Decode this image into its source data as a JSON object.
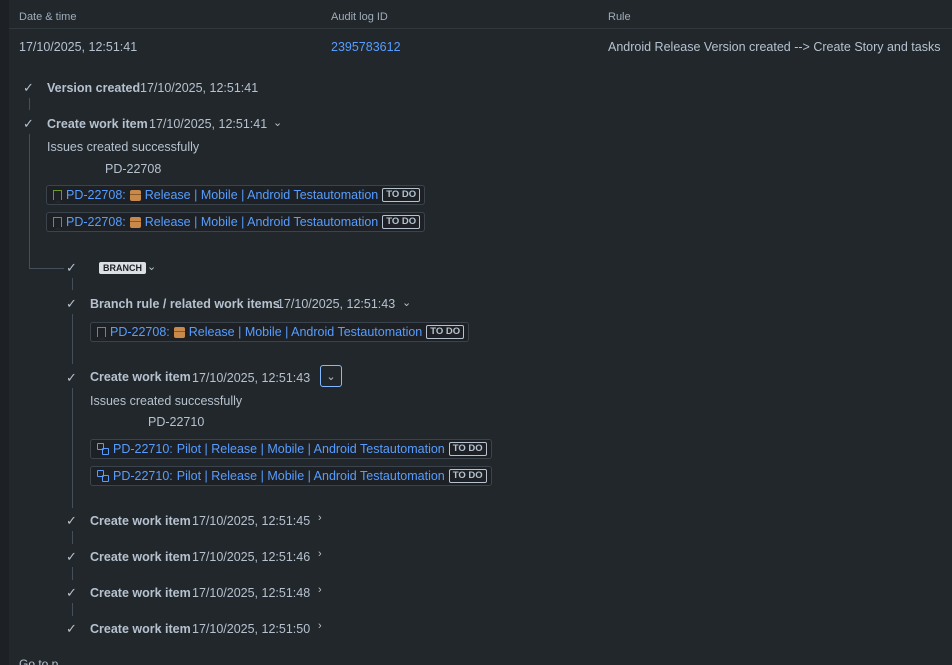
{
  "header": {
    "col_date": "Date & time",
    "col_id": "Audit log ID",
    "col_rule": "Rule"
  },
  "entry": {
    "date": "17/10/2025, 12:51:41",
    "id": "2395783612",
    "rule": "Android Release Version created --> Create Story and tasks"
  },
  "steps": {
    "version_created": {
      "title": "Version created",
      "time": "17/10/2025, 12:51:41"
    },
    "create1": {
      "title": "Create work item",
      "time": "17/10/2025, 12:51:41",
      "message": "Issues created successfully",
      "key": "PD-22708",
      "items": [
        {
          "key": "PD-22708:",
          "summary": "Release | Mobile | Android Testautomation",
          "status": "TO DO"
        },
        {
          "key": "PD-22708:",
          "summary": "Release | Mobile | Android Testautomation",
          "status": "TO DO"
        }
      ]
    },
    "branch_label": "BRANCH",
    "branch_rule": {
      "title": "Branch rule / related work items",
      "time": "17/10/2025, 12:51:43",
      "item": {
        "key": "PD-22708:",
        "summary": "Release | Mobile | Android Testautomation",
        "status": "TO DO"
      }
    },
    "create2": {
      "title": "Create work item",
      "time": "17/10/2025, 12:51:43",
      "message": "Issues created successfully",
      "key": "PD-22710",
      "items": [
        {
          "key": "PD-22710:",
          "summary": "Pilot | Release | Mobile | Android Testautomation",
          "status": "TO DO"
        },
        {
          "key": "PD-22710:",
          "summary": "Pilot | Release | Mobile | Android Testautomation",
          "status": "TO DO"
        }
      ]
    },
    "create3": {
      "title": "Create work item",
      "time": "17/10/2025, 12:51:45"
    },
    "create4": {
      "title": "Create work item",
      "time": "17/10/2025, 12:51:46"
    },
    "create5": {
      "title": "Create work item",
      "time": "17/10/2025, 12:51:48"
    },
    "create6": {
      "title": "Create work item",
      "time": "17/10/2025, 12:51:50"
    }
  },
  "icons": {
    "check": "check-icon",
    "chevron_down": "chevron-down-icon",
    "chevron_right": "chevron-right-icon",
    "story": "story-icon",
    "subtask": "subtask-icon",
    "package": "package-emoji-icon"
  },
  "colors": {
    "link": "#579dff",
    "background": "#22272b",
    "story_icon": "#6a9a23"
  },
  "bottom_text": "Go to p..."
}
